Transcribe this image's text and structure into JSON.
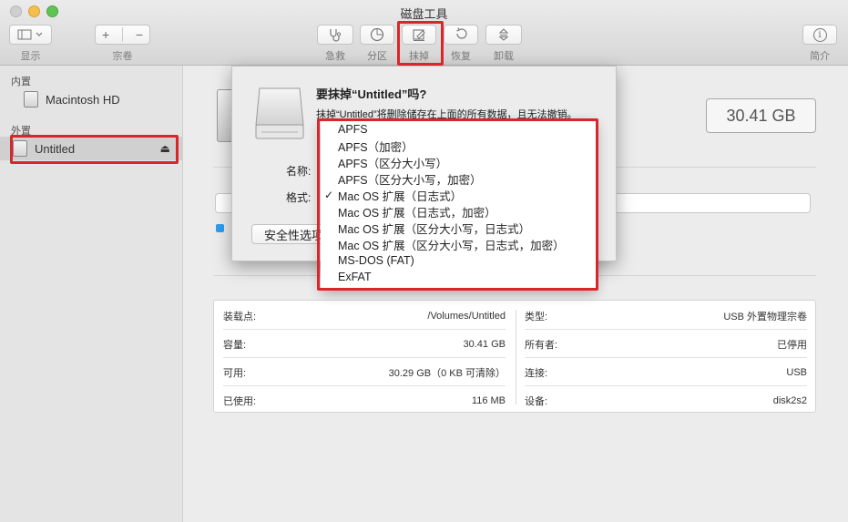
{
  "window": {
    "title": "磁盘工具"
  },
  "toolbar": {
    "view_label": "显示",
    "volume_label": "宗卷",
    "add_symbol": "+",
    "remove_symbol": "−",
    "firstaid_label": "急救",
    "partition_label": "分区",
    "erase_label": "抹掉",
    "restore_label": "恢复",
    "unmount_label": "卸载",
    "info_label": "简介",
    "info_symbol": "i"
  },
  "sidebar": {
    "internal_section": "内置",
    "external_section": "外置",
    "internal_items": [
      {
        "label": "Macintosh HD"
      }
    ],
    "external_items": [
      {
        "label": "Untitled",
        "eject": "⏏"
      }
    ]
  },
  "main": {
    "capacity": "30.41 GB",
    "info": {
      "mount_point_label": "装载点:",
      "mount_point_value": "/Volumes/Untitled",
      "capacity_label": "容量:",
      "capacity_value": "30.41 GB",
      "available_label": "可用:",
      "available_value": "30.29 GB（0 KB 可清除）",
      "used_label": "已使用:",
      "used_value": "116 MB",
      "type_label": "类型:",
      "type_value": "USB 外置物理宗卷",
      "owners_label": "所有者:",
      "owners_value": "已停用",
      "connection_label": "连接:",
      "connection_value": "USB",
      "device_label": "设备:",
      "device_value": "disk2s2"
    }
  },
  "sheet": {
    "title": "要抹掉“Untitled”吗?",
    "description": "抹掉“Untitled”将删除储存在上面的所有数据，且无法撤销。",
    "name_label": "名称:",
    "format_label": "格式:",
    "security_button": "安全性选项..."
  },
  "format_menu": {
    "selected_index": 4,
    "check_mark": "✓",
    "items": [
      "APFS",
      "APFS（加密）",
      "APFS（区分大小写）",
      "APFS（区分大小写，加密）",
      "Mac OS 扩展（日志式）",
      "Mac OS 扩展（日志式，加密）",
      "Mac OS 扩展（区分大小写，日志式）",
      "Mac OS 扩展（区分大小写，日志式，加密）",
      "MS-DOS (FAT)",
      "ExFAT"
    ]
  },
  "colors": {
    "highlight": "#d9262a",
    "accent": "#2d9cf0"
  }
}
